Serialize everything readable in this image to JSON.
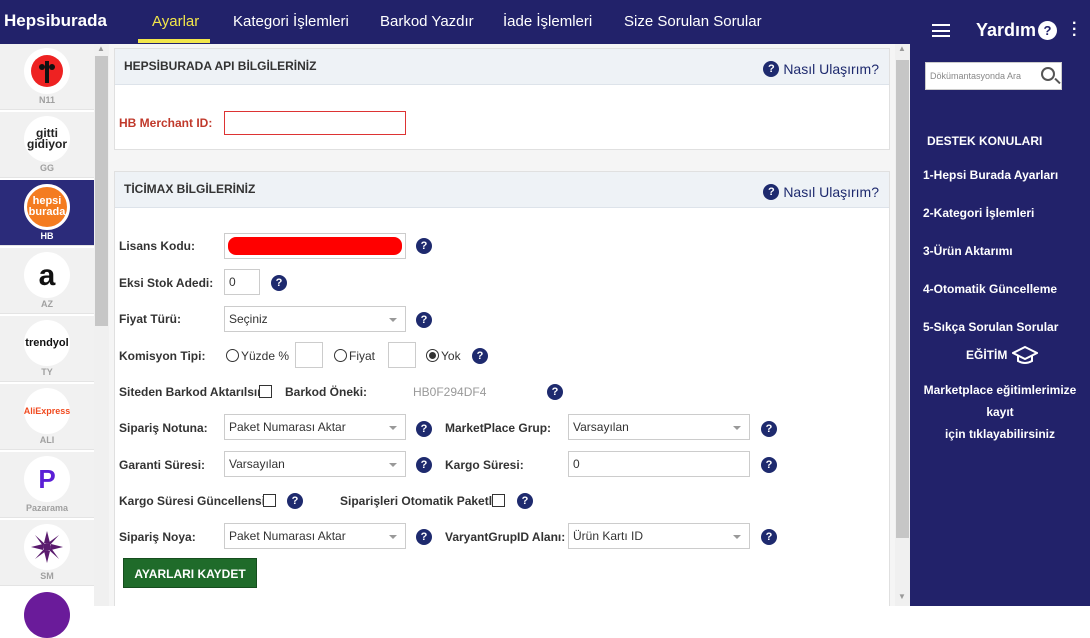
{
  "topbar": {
    "brand": "Hepsiburada",
    "tabs": [
      "Ayarlar",
      "Kategori İşlemleri",
      "Barkod Yazdır",
      "İade İşlemleri",
      "Size Sorulan Sorular"
    ]
  },
  "marketplaces": [
    {
      "code": "N11",
      "logo": "n11"
    },
    {
      "code": "GG",
      "logo": "gitti gidiyor"
    },
    {
      "code": "HB",
      "logo": "hepsi burada"
    },
    {
      "code": "AZ",
      "logo": "a"
    },
    {
      "code": "TY",
      "logo": "trendyol"
    },
    {
      "code": "ALI",
      "logo": "AliExpress"
    },
    {
      "code": "Pazarama",
      "logo": "P"
    },
    {
      "code": "SM",
      "logo": ""
    }
  ],
  "api_panel": {
    "title": "HEPSİBURADA API BİLGİLERİNİZ",
    "help": "Nasıl Ulaşırım?",
    "merchant_label": "HB Merchant ID:",
    "merchant_value": ""
  },
  "ticimax_panel": {
    "title": "TİCİMAX BİLGİLERİNİZ",
    "help": "Nasıl Ulaşırım?",
    "lisans_label": "Lisans Kodu:",
    "eksi_label": "Eksi Stok Adedi:",
    "eksi_value": "0",
    "fiyat_label": "Fiyat Türü:",
    "fiyat_value": "Seçiniz",
    "komisyon_label": "Komisyon Tipi:",
    "opt_yuzde": "Yüzde %",
    "opt_fiyat": "Fiyat",
    "opt_yok": "Yok",
    "barkod_aktar_label": "Siteden Barkod Aktarılsın",
    "barkod_onek_label": "Barkod Öneki:",
    "barkod_onek_value": "HB0F294DF4",
    "siparis_notu_label": "Sipariş Notuna:",
    "siparis_notu_value": "Paket Numarası Aktar",
    "mp_grup_label": "MarketPlace Grup:",
    "mp_grup_value": "Varsayılan",
    "garanti_label": "Garanti Süresi:",
    "garanti_value": "Varsayılan",
    "kargo_label": "Kargo Süresi:",
    "kargo_value": "0",
    "kargo_guncel_label": "Kargo Süresi Güncellensin",
    "oto_paket_label": "Siparişleri Otomatik Paketle",
    "siparis_noya_label": "Sipariş Noya:",
    "siparis_noya_value": "Paket Numarası Aktar",
    "varyant_label": "VaryantGrupID Alanı:",
    "varyant_value": "Ürün Kartı ID",
    "save": "AYARLARI KAYDET"
  },
  "right": {
    "title": "Yardım",
    "search_placeholder": "Dökümantasyonda Ara",
    "section": "DESTEK KONULARI",
    "items": [
      "1-Hepsi Burada Ayarları",
      "2-Kategori İşlemleri",
      "3-Ürün Aktarımı",
      "4-Otomatik Güncelleme",
      "5-Sıkça Sorulan Sorular"
    ],
    "egitim": "EĞİTİM",
    "egitim_text1": "Marketplace eğitimlerimize kayıt",
    "egitim_text2": "için tıklayabilirsiniz"
  }
}
